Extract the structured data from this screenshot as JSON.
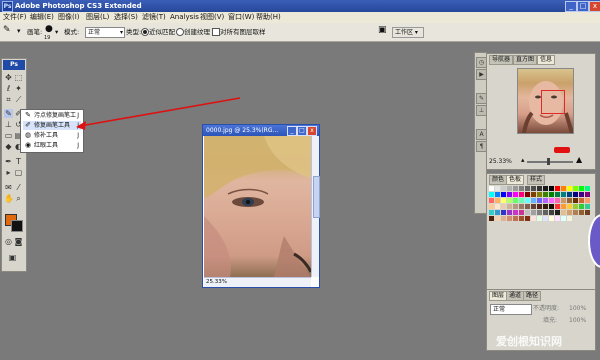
{
  "window": {
    "title": "Adobe Photoshop CS3 Extended",
    "app_badge": "Ps",
    "controls": [
      "_",
      "□",
      "x"
    ]
  },
  "menu": [
    "文件(F)",
    "编辑(E)",
    "图像(I)",
    "图层(L)",
    "选择(S)",
    "滤镜(T)",
    "Analysis",
    "视图(V)",
    "窗口(W)",
    "帮助(H)"
  ],
  "options": {
    "brush_label": "画笔:",
    "brush_size": "19",
    "mode_label": "模式:",
    "mode_value": "正常",
    "type_label": "类型:",
    "radio1": "近似匹配",
    "radio2": "创建纹理",
    "checkbox": "对所有图层取样",
    "workspace": "工作区 ▾"
  },
  "toolbox": {
    "badge": "Ps"
  },
  "flyout": {
    "items": [
      {
        "label": "污点修复画笔工具",
        "shortcut": "J",
        "icon": "spot-heal-icon"
      },
      {
        "label": "修复画笔工具",
        "shortcut": "J",
        "icon": "heal-brush-icon"
      },
      {
        "label": "修补工具",
        "shortcut": "J",
        "icon": "patch-icon"
      },
      {
        "label": "红眼工具",
        "shortcut": "J",
        "icon": "red-eye-icon"
      }
    ]
  },
  "document": {
    "title": "0000.jpg @ 25.3%(RG...",
    "status": "25.33%"
  },
  "navigator": {
    "tabs": [
      "导航器",
      "直方图",
      "信息"
    ],
    "zoom": "25.33%"
  },
  "swatches": {
    "tabs": [
      "颜色",
      "色板",
      "样式"
    ],
    "colors": [
      "#ffffff",
      "#e6e6e6",
      "#cccccc",
      "#b3b3b3",
      "#999999",
      "#808080",
      "#666666",
      "#4d4d4d",
      "#333333",
      "#1a1a1a",
      "#000000",
      "#ff0000",
      "#ff8000",
      "#ffff00",
      "#80ff00",
      "#00ff00",
      "#00ff80",
      "#00ffff",
      "#0080ff",
      "#0000ff",
      "#8000ff",
      "#ff00ff",
      "#ff0080",
      "#800000",
      "#804000",
      "#808000",
      "#408000",
      "#008000",
      "#008040",
      "#008080",
      "#004080",
      "#000080",
      "#400080",
      "#800080",
      "#ff6666",
      "#ffb366",
      "#ffff66",
      "#b3ff66",
      "#66ff66",
      "#66ffb3",
      "#66ffff",
      "#66b3ff",
      "#6666ff",
      "#b366ff",
      "#ff66ff",
      "#ff66b3",
      "#cc9966",
      "#996633",
      "#663300",
      "#cc6633",
      "#ff9966",
      "#ffcc99",
      "#ffe6cc",
      "#e6ccb3",
      "#ccb399",
      "#b39980",
      "#997a66",
      "#806050",
      "#664033",
      "#4d2619",
      "#331a0d",
      "#1a0d00",
      "#ff3333",
      "#ff9933",
      "#ffcc33",
      "#99cc33",
      "#33cc33",
      "#33cc99",
      "#33cccc",
      "#3399cc",
      "#3333cc",
      "#9933cc",
      "#cc33cc",
      "#cc3399",
      "#c0c0c0",
      "#a0a0a0",
      "#808080",
      "#606060",
      "#404040",
      "#202020",
      "#e0c090",
      "#d0a070",
      "#b08050",
      "#906030",
      "#704020",
      "#502010",
      "#f0d0b0",
      "#e0b090",
      "#d09070",
      "#c07050",
      "#a05030",
      "#803010",
      "#ffe0e0",
      "#e0ffe0",
      "#e0e0ff",
      "#ffffe0",
      "#ffe0ff",
      "#e0ffff",
      "#f5f5dc"
    ]
  },
  "layers": {
    "tabs": [
      "图层",
      "通道",
      "路径"
    ],
    "mode": "正常",
    "opacity_label": "不透明度:",
    "opacity": "100%",
    "fill_label": "填充:",
    "fill": "100%"
  },
  "watermark": "爱创根知识网"
}
